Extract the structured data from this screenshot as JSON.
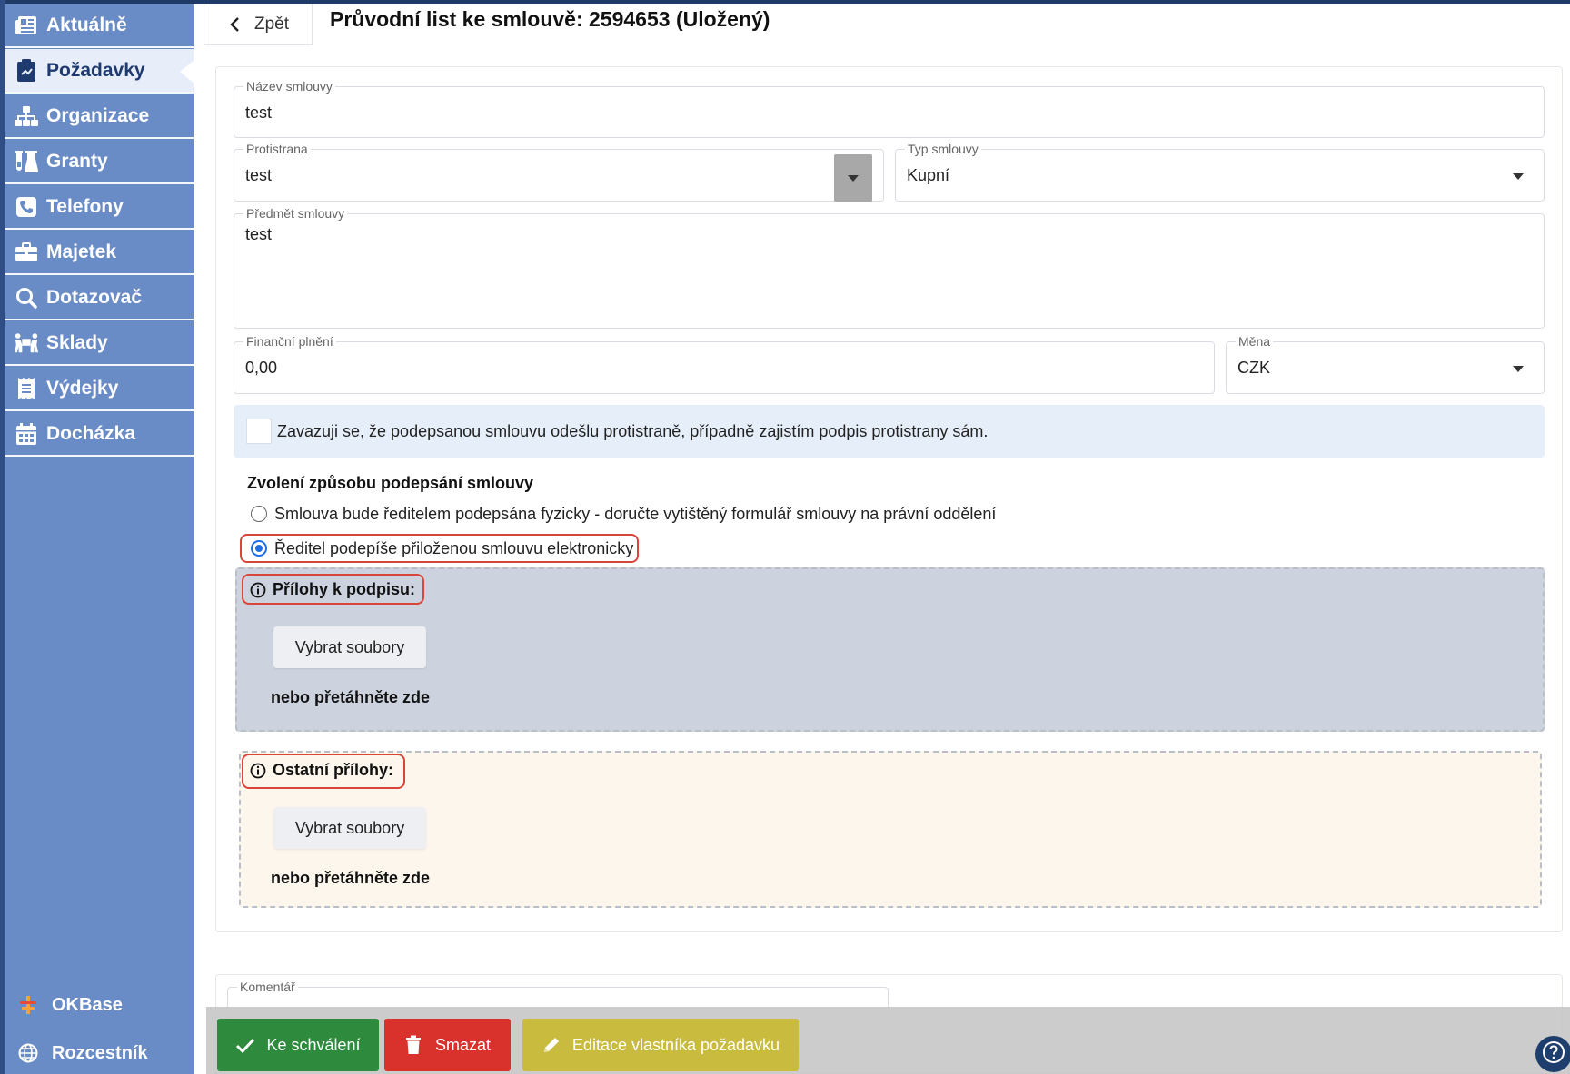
{
  "sidebar": {
    "items": [
      {
        "label": "Aktuálně",
        "icon": "newspaper-icon"
      },
      {
        "label": "Požadavky",
        "icon": "clipboard-icon"
      },
      {
        "label": "Organizace",
        "icon": "sitemap-icon"
      },
      {
        "label": "Granty",
        "icon": "flask-icon"
      },
      {
        "label": "Telefony",
        "icon": "phone-icon"
      },
      {
        "label": "Majetek",
        "icon": "briefcase-icon"
      },
      {
        "label": "Dotazovač",
        "icon": "search-icon"
      },
      {
        "label": "Sklady",
        "icon": "people-carry-icon"
      },
      {
        "label": "Výdejky",
        "icon": "receipt-icon"
      },
      {
        "label": "Docházka",
        "icon": "calendar-icon"
      }
    ],
    "active_index": 1,
    "footer": [
      {
        "label": "OKBase",
        "icon": "okbase-logo-icon"
      },
      {
        "label": "Rozcestník",
        "icon": "globe-icon"
      }
    ]
  },
  "header": {
    "back_label": "Zpět",
    "title": "Průvodní list ke smlouvě: 2594653 (Uložený)"
  },
  "form": {
    "contract_name": {
      "label": "Název smlouvy",
      "value": "test"
    },
    "counterparty": {
      "label": "Protistrana",
      "value": "test"
    },
    "contract_type": {
      "label": "Typ smlouvy",
      "value": "Kupní"
    },
    "subject": {
      "label": "Předmět smlouvy",
      "value": "test"
    },
    "financial": {
      "label": "Finanční plnění",
      "value": "0,00"
    },
    "currency": {
      "label": "Měna",
      "value": "CZK"
    },
    "commitment": {
      "text": "Zavazuji se, že podepsanou smlouvu odešlu protistraně, případně zajistím podpis protistrany sám.",
      "checked": false
    },
    "signing": {
      "title": "Zvolení způsobu podepsání smlouvy",
      "options": [
        {
          "label": "Smlouva bude ředitelem podepsána fyzicky - doručte vytištěný formulář smlouvy na právní oddělení",
          "selected": false
        },
        {
          "label": "Ředitel podepíše přiloženou smlouvu elektronicky",
          "selected": true
        }
      ]
    },
    "attachments_sign": {
      "title": "Přílohy k podpisu:",
      "button": "Vybrat soubory",
      "hint": "nebo přetáhněte zde",
      "color": "#ccd3de"
    },
    "attachments_other": {
      "title": "Ostatní přílohy:",
      "button": "Vybrat soubory",
      "hint": "nebo přetáhněte zde",
      "color": "#fdf6ec"
    }
  },
  "comment": {
    "label": "Komentář",
    "value": ""
  },
  "actions": {
    "approve": {
      "label": "Ke schválení",
      "color": "#2e8b3e"
    },
    "delete": {
      "label": "Smazat",
      "color": "#d9312b"
    },
    "edit_owner": {
      "label": "Editace vlastníka požadavku",
      "color": "#c8bb3e"
    }
  },
  "colors": {
    "sidebar": "#6a8cc6",
    "highlight": "#d8453b",
    "accent": "#1f6fe0"
  }
}
